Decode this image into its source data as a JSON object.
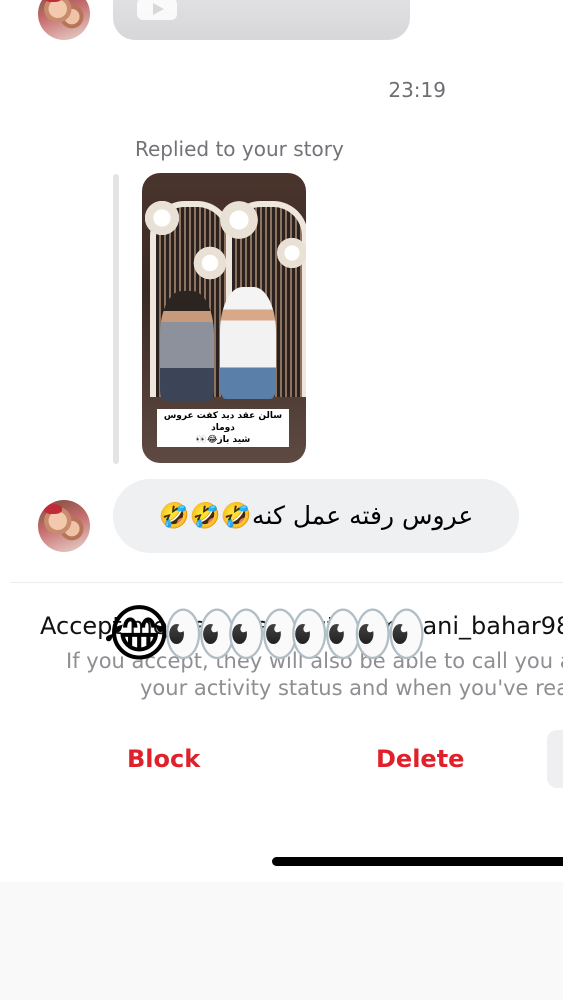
{
  "timestamp": "23:19",
  "story_reply": {
    "label": "Replied to your story",
    "sticker_line1": "سالن عقد دید کفت عروس دوماد",
    "sticker_line2": "شید باز😂👀"
  },
  "message": {
    "text": "عروس رفته عمل کنه🤣🤣🤣"
  },
  "request": {
    "title": "Accept message request from hani_bahar98",
    "info_line1": "If you accept, they will also be able to call you a",
    "info_line2": "your activity status and when you've rea"
  },
  "emoji_overlay": "😂👀👀👀👀",
  "actions": {
    "block_label": "Block",
    "delete_label": "Delete"
  },
  "colors": {
    "action_red": "#e0202a",
    "bubble_gray": "#eff0f2",
    "meta_gray": "#6e6e73"
  }
}
